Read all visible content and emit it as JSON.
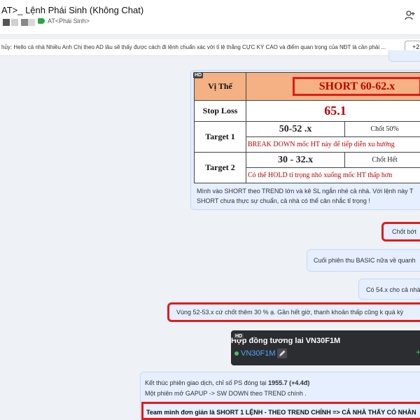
{
  "header": {
    "title": "AT>_ Lệnh Phái Sinh (Không Chat)",
    "label_tag": "AT<Phái Sinh>"
  },
  "pinned": {
    "text": "hủy: Hello cả nhà Nhiều Anh Chị theo AD lâu sẽ thấy được cách đi lệnh chuẩn xác với tỉ lệ thắng CỰC KỲ CAO và điểm quan trọng của NĐT là cần phải ...",
    "button_label": "+2"
  },
  "signal_table": {
    "hd_badge": "HD",
    "vithe_label": "Vị Thế",
    "vithe_value": "SHORT 60-62.x",
    "stoploss_label": "Stop Loss",
    "stoploss_value": "65.1",
    "target1_label": "Target 1",
    "target1_value": "50-52 .x",
    "target1_action": "Chốt 50%",
    "target1_note": "BREAK DOWN mốc HT này để tiếp diễn xu hướng",
    "target2_label": "Target 2",
    "target2_value": "30 - 32.x",
    "target2_action": "Chốt Hết",
    "target2_note": "Có thể HOLD tỉ trọng nhỏ xuống mốc HT thấp hơn"
  },
  "messages": {
    "caption": "Mình vào SHORT theo TREND lớn và kê SL ngắn nhé cả nhà. Với lệnh này T SHORT chưa thực sự chuẩn, cả nhà có thể cân nhắc tỉ trọng !",
    "chot_bot": "Chốt bớt",
    "cuoi_phien": "Cuối phiên thu BASIC nữa về quanh",
    "co_54": "Có 54.x cho cả nhà",
    "vung_52": "Vùng 52-53.x cứ chốt thêm 30 % ạ. Gần hết giờ, thanh khoản thấp cũng k quá kỳ"
  },
  "card": {
    "hd_badge": "HD",
    "title": "Hợp đồng tương lai VN30F1M",
    "code": "VN30F1M",
    "plus": "+"
  },
  "final": {
    "line1_prefix": "Kết thúc phiên giao dịch, chỉ số PS đóng tại ",
    "line1_value": "1955.7 (+4.4đ)",
    "line2": "Một phiên mở GAPUP -> SW DOWN theo TREND chính .",
    "line3": "Team mình đơn giản là SHORT 1 LỆNH - THEO TREND CHÍNH => CẢ NHÀ THẤY CÓ NHÀN"
  },
  "colors": {
    "accent_red": "#e01b1b",
    "bubble_bg": "#e5efff",
    "tag_green": "#27a844",
    "header_orange": "#f4b183"
  }
}
